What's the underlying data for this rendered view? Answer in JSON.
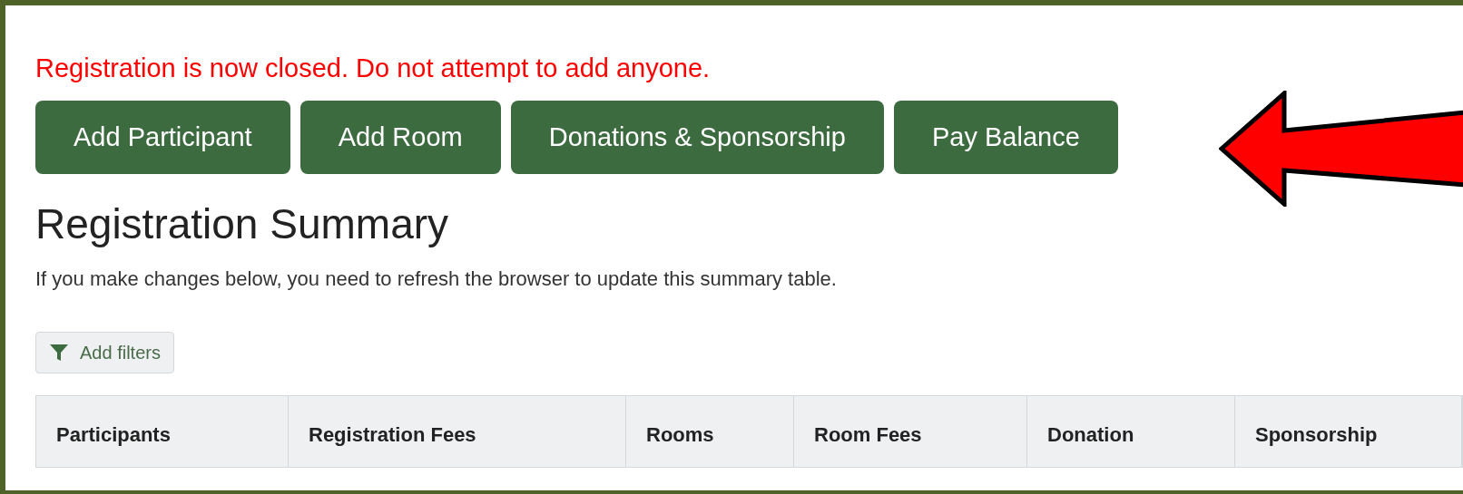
{
  "notice": "Registration is now closed. Do not attempt to add anyone.",
  "buttons": [
    "Add Participant",
    "Add Room",
    "Donations & Sponsorship",
    "Pay Balance"
  ],
  "heading": "Registration Summary",
  "description": "If you make changes below, you need to refresh the browser to update this summary table.",
  "filter_button": "Add filters",
  "table": {
    "columns": [
      "Participants",
      "Registration Fees",
      "Rooms",
      "Room Fees",
      "Donation",
      "Sponsorship"
    ]
  }
}
